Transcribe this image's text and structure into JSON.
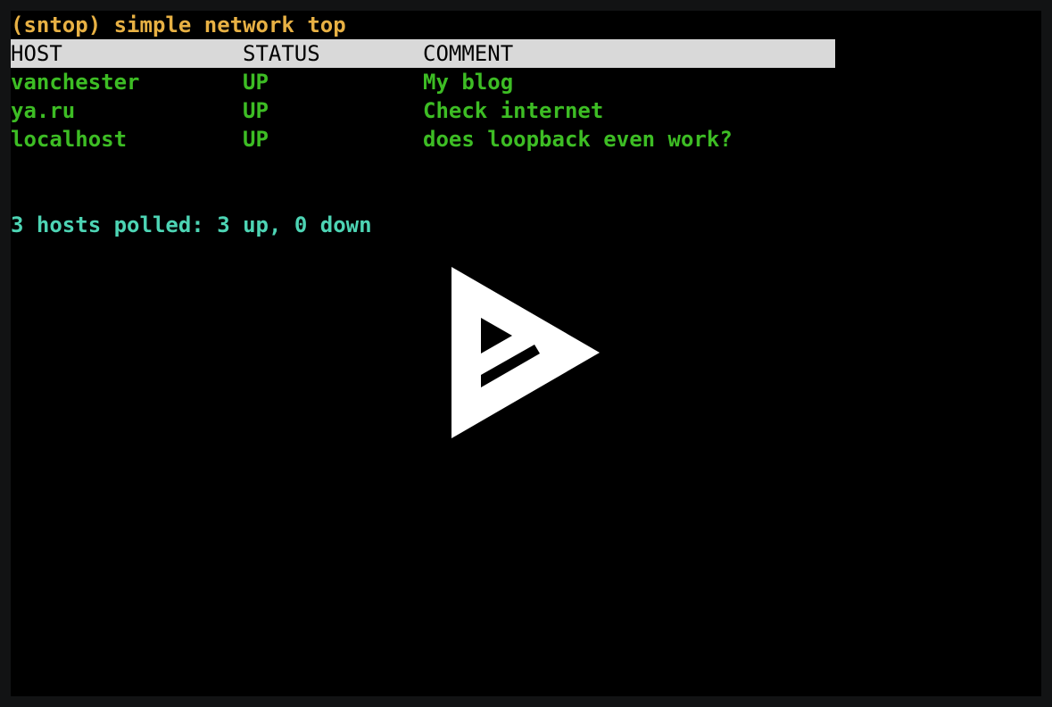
{
  "terminal": {
    "title": "(sntop) simple network top",
    "columns": {
      "host": "HOST",
      "status": "STATUS",
      "comment": "COMMENT"
    },
    "rows": [
      {
        "host": "vanchester",
        "status": "UP",
        "comment": "My blog"
      },
      {
        "host": "ya.ru",
        "status": "UP",
        "comment": "Check internet"
      },
      {
        "host": "localhost",
        "status": "UP",
        "comment": "does loopback even work?"
      }
    ],
    "summary": "3 hosts polled: 3 up, 0 down"
  },
  "overlay": {
    "icon": "asciinema-play-icon"
  },
  "colors": {
    "background": "#000000",
    "title": "#e8b144",
    "header_bg": "#d9d9d9",
    "row_text": "#3dbd24",
    "summary_text": "#4dd4b4",
    "overlay": "#ffffff"
  }
}
